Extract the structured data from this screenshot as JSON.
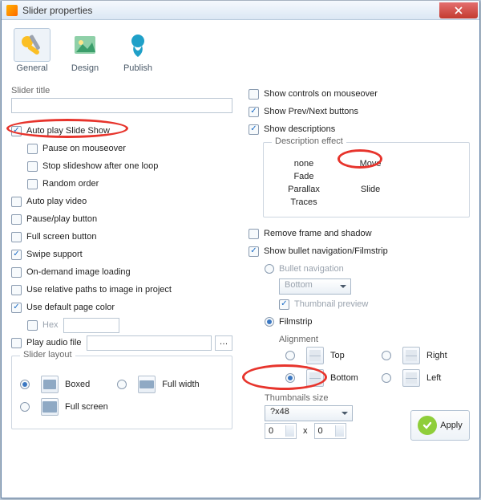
{
  "window": {
    "title": "Slider properties"
  },
  "tabs": [
    {
      "id": "general",
      "label": "General",
      "selected": true
    },
    {
      "id": "design",
      "label": "Design",
      "selected": false
    },
    {
      "id": "publish",
      "label": "Publish",
      "selected": false
    }
  ],
  "left": {
    "slider_title_label": "Slider title",
    "slider_title_value": "",
    "auto_play": "Auto play Slide Show",
    "pause_mouseover": "Pause on mouseover",
    "stop_after_loop": "Stop slideshow after one loop",
    "random_order": "Random order",
    "auto_play_video": "Auto play video",
    "pause_play_btn": "Pause/play button",
    "full_screen_btn": "Full screen button",
    "swipe_support": "Swipe support",
    "on_demand": "On-demand image loading",
    "relative_paths": "Use relative paths to image in project",
    "default_page_color": "Use default page color",
    "hex_label": "Hex",
    "hex_value": "",
    "play_audio": "Play audio file",
    "audio_value": "",
    "slider_layout": "Slider layout",
    "boxed": "Boxed",
    "full_width": "Full width",
    "full_screen": "Full screen"
  },
  "right": {
    "show_controls": "Show controls on mouseover",
    "show_prevnext": "Show Prev/Next buttons",
    "show_desc": "Show descriptions",
    "desc_effect": "Description effect",
    "desc_opts": [
      "none",
      "Move",
      "Fade",
      "Parallax",
      "Slide",
      "Traces"
    ],
    "remove_frame": "Remove frame and shadow",
    "show_bullet": "Show bullet navigation/Filmstrip",
    "bullet_nav": "Bullet navigation",
    "bullet_pos": "Bottom",
    "thumb_preview": "Thumbnail preview",
    "filmstrip": "Filmstrip",
    "alignment": "Alignment",
    "align_top": "Top",
    "align_right": "Right",
    "align_bottom": "Bottom",
    "align_left": "Left",
    "thumb_size_label": "Thumbnails size",
    "thumb_size_value": "?x48",
    "thumb_w": "0",
    "x": "x",
    "thumb_h": "0"
  },
  "apply": "Apply"
}
